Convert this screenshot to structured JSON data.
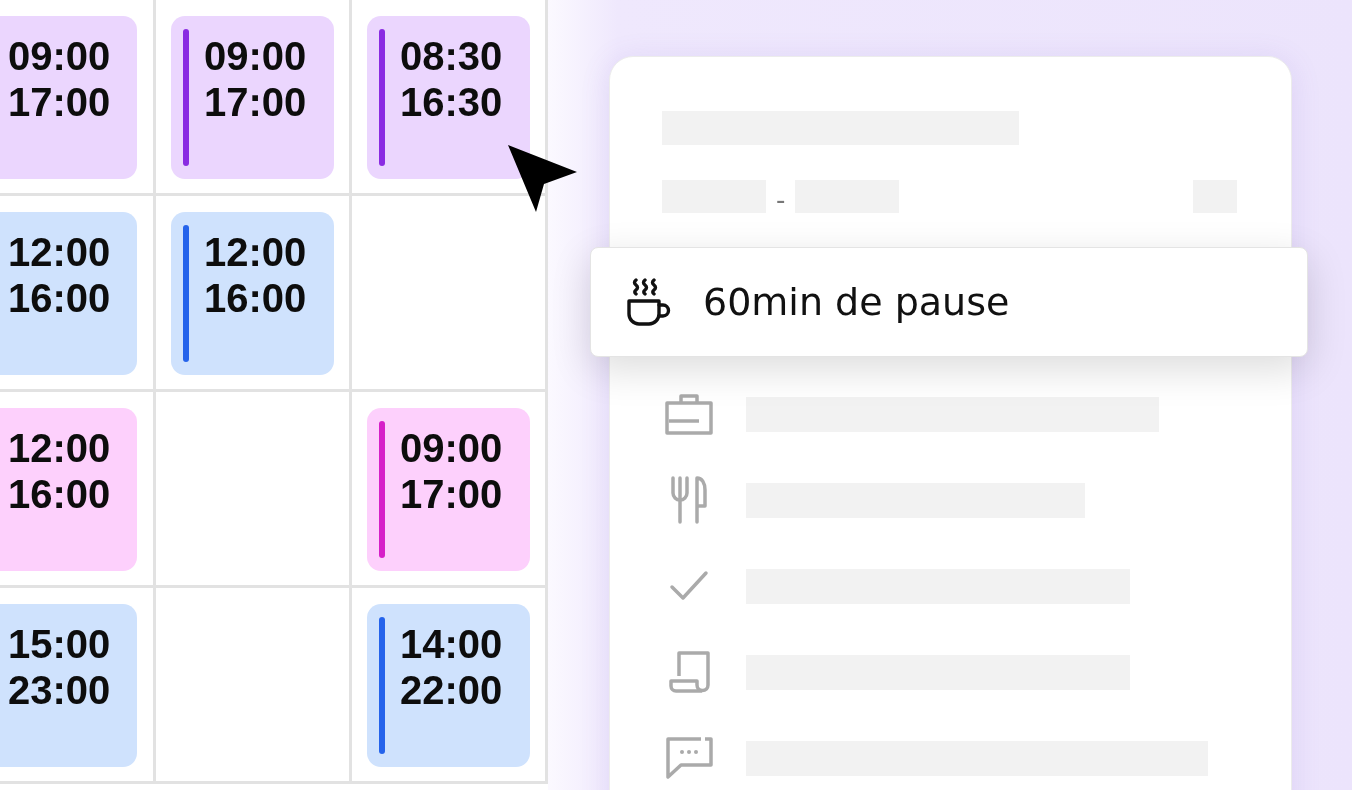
{
  "schedule": {
    "rows": [
      {
        "cells": [
          {
            "kind": "shift",
            "start": "09:00",
            "end": "17:00",
            "color": "#ebd6fe"
          },
          {
            "kind": "shift",
            "start": "09:00",
            "end": "17:00",
            "color": "#ebd6fe",
            "accent": {
              "color": "#8a2be2"
            }
          },
          {
            "kind": "shift",
            "start": "08:30",
            "end": "16:30",
            "color": "#ebd6fe",
            "accent": {
              "color": "#8a2be2"
            }
          }
        ]
      },
      {
        "cells": [
          {
            "kind": "shift",
            "start": "12:00",
            "end": "16:00",
            "color": "#cfe2fd"
          },
          {
            "kind": "shift",
            "start": "12:00",
            "end": "16:00",
            "color": "#cfe2fd",
            "accent": {
              "color": "#2563eb"
            }
          },
          {
            "kind": "empty"
          }
        ]
      },
      {
        "cells": [
          {
            "kind": "shift",
            "start": "12:00",
            "end": "16:00",
            "color": "#fdd0fc"
          },
          {
            "kind": "empty"
          },
          {
            "kind": "shift",
            "start": "09:00",
            "end": "17:00",
            "color": "#fdd0fc",
            "accent": {
              "color": "#d61fc8"
            }
          }
        ]
      },
      {
        "cells": [
          {
            "kind": "shift",
            "start": "15:00",
            "end": "23:00",
            "color": "#cfe2fd"
          },
          {
            "kind": "empty"
          },
          {
            "kind": "shift",
            "start": "14:00",
            "end": "22:00",
            "color": "#cfe2fd",
            "accent": {
              "color": "#2563eb"
            }
          }
        ]
      }
    ]
  },
  "details_panel": {
    "time_separator": "-",
    "break_popup": {
      "label": "60min de pause"
    }
  }
}
